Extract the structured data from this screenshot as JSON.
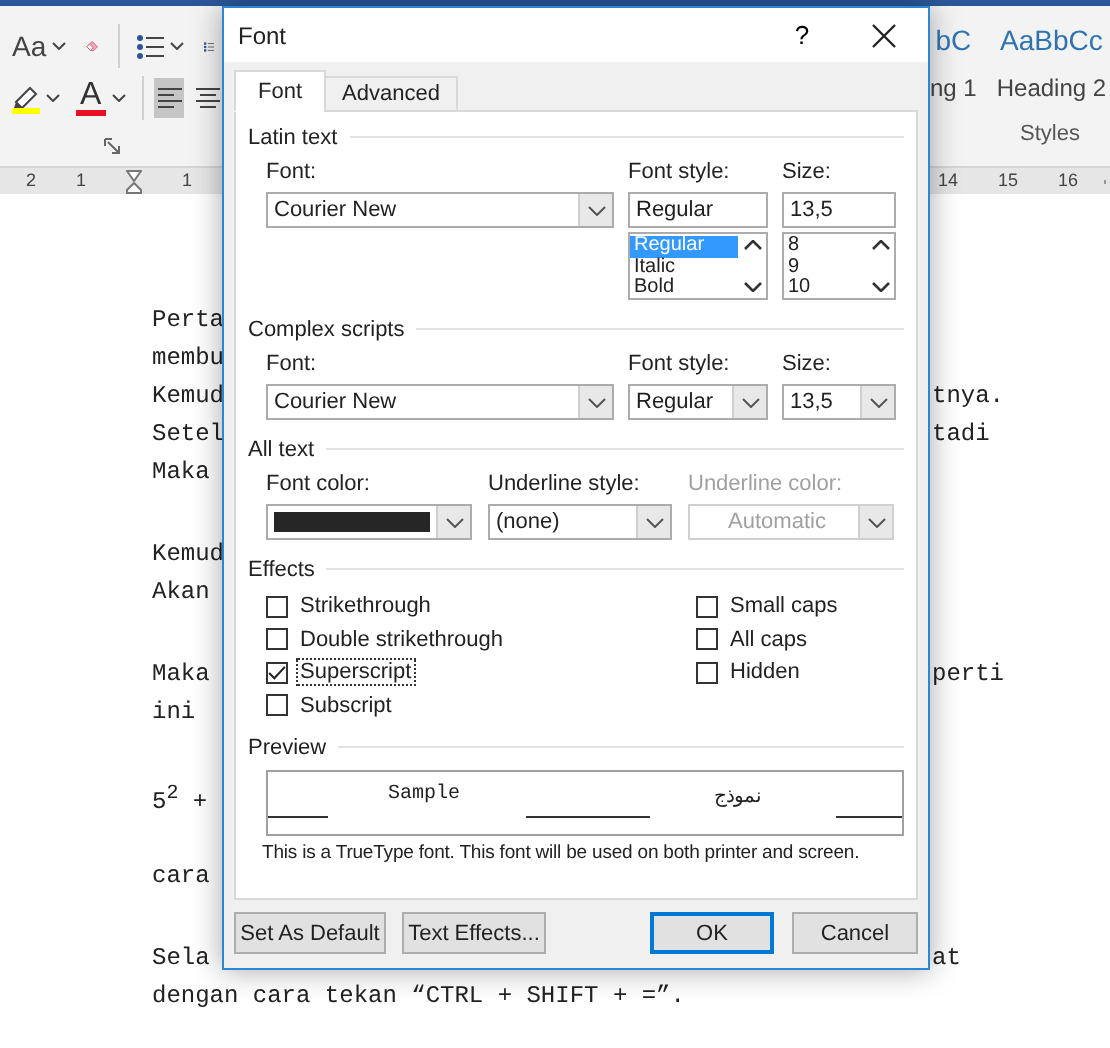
{
  "ribbon": {
    "change_case": "Aa",
    "font_color": "A",
    "align_buttons": [
      {
        "kind": "left",
        "selected": true
      },
      {
        "kind": "center",
        "selected": false
      }
    ],
    "styles": [
      {
        "preview": "bC",
        "name": "ng 1"
      },
      {
        "preview": "AaBbCc",
        "name": "Heading 2"
      }
    ],
    "styles_group_label": "Styles"
  },
  "ruler": {
    "left_numbers": [
      "2",
      "1"
    ],
    "after_indent": [
      "1"
    ],
    "right_numbers": [
      "14",
      "15",
      "16"
    ]
  },
  "document": {
    "paragraphs": [
      [
        {
          "left": "Perta"
        },
        {
          "left": "membu"
        },
        {
          "left": "Kemud",
          "right": "tnya."
        },
        {
          "left": "Setel",
          "right": "tadi"
        },
        {
          "left": "Maka"
        }
      ],
      [
        {
          "left": "Kemud"
        },
        {
          "left": "Akan"
        }
      ],
      [
        {
          "left": "Maka",
          "right": "perti"
        },
        {
          "left": "ini"
        }
      ],
      [
        {
          "left": "5$^{2}$ +"
        }
      ],
      [
        {
          "left": "cara"
        }
      ],
      [
        {
          "left": "Sela",
          "right": "at"
        },
        {
          "left": "dengan cara tekan “CTRL + SHIFT + =”."
        }
      ]
    ]
  },
  "dialog": {
    "title": "Font",
    "help": "?",
    "tabs": [
      {
        "label": "Font",
        "selected": true
      },
      {
        "label": "Advanced",
        "selected": false
      }
    ],
    "latin": {
      "heading": "Latin text",
      "font_label": "Font:",
      "font": "Courier New",
      "style_label": "Font style:",
      "style": "Regular",
      "styles": [
        {
          "label": "Regular",
          "selected": true
        },
        {
          "label": "Italic",
          "selected": false
        },
        {
          "label": "Bold",
          "selected": false
        }
      ],
      "size_label": "Size:",
      "size": "13,5",
      "sizes": [
        {
          "label": "8",
          "selected": false
        },
        {
          "label": "9",
          "selected": false
        },
        {
          "label": "10",
          "selected": false
        }
      ]
    },
    "complex": {
      "heading": "Complex scripts",
      "font_label": "Font:",
      "font": "Courier New",
      "style_label": "Font style:",
      "style": "Regular",
      "size_label": "Size:",
      "size": "13,5"
    },
    "all_text": {
      "heading": "All text",
      "color_label": "Font color:",
      "underline_label": "Underline style:",
      "underline": "(none)",
      "underline_color_label": "Underline color:",
      "underline_color": "Automatic",
      "underline_color_disabled": true
    },
    "effects": {
      "heading": "Effects",
      "left": [
        {
          "label": "Strikethrough",
          "checked": false,
          "focused": false
        },
        {
          "label": "Double strikethrough",
          "checked": false,
          "focused": false
        },
        {
          "label": "Superscript",
          "checked": true,
          "focused": true
        },
        {
          "label": "Subscript",
          "checked": false,
          "focused": false
        }
      ],
      "right": [
        {
          "label": "Small caps",
          "checked": false,
          "focused": false
        },
        {
          "label": "All caps",
          "checked": false,
          "focused": false
        },
        {
          "label": "Hidden",
          "checked": false,
          "focused": false
        }
      ]
    },
    "preview": {
      "heading": "Preview",
      "sample": "Sample",
      "sample_rtl": "نموذج",
      "note": "This is a TrueType font. This font will be used on both printer and screen."
    },
    "buttons": [
      {
        "label": "Set As Default",
        "default": false
      },
      {
        "label": "Text Effects...",
        "default": false
      },
      {
        "label": "OK",
        "default": true
      },
      {
        "label": "Cancel",
        "default": false
      }
    ]
  }
}
